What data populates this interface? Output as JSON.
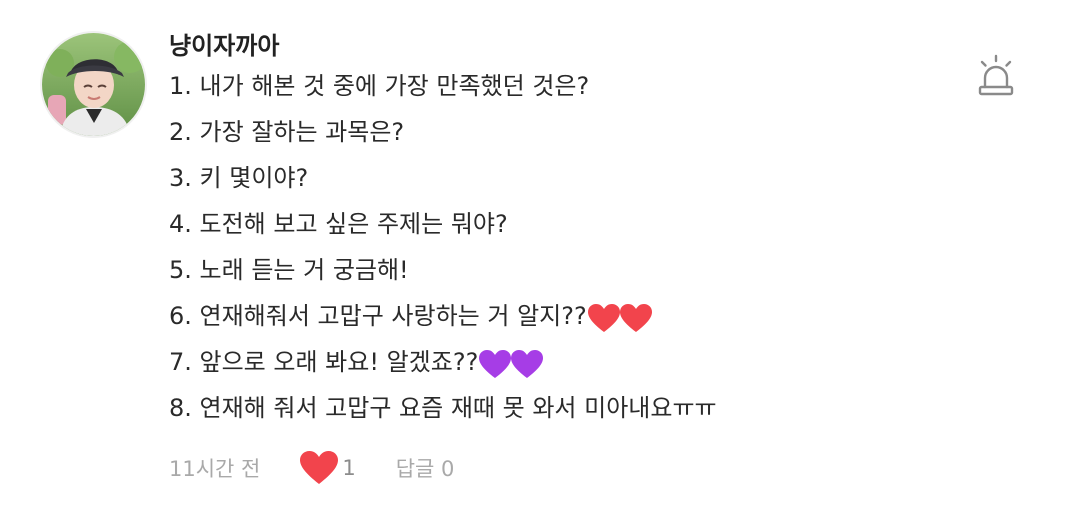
{
  "comment": {
    "author": "냥이자까아",
    "lines": [
      "1. 내가 해본 것 중에 가장 만족했던 것은?",
      "2. 가장 잘하는 과목은?",
      "3. 키 몇이야?",
      "4. 도전해 보고 싶은 주제는 뭐야?",
      "5. 노래 듣는 거 궁금해!",
      "6. 연재해줘서 고맙구 사랑하는 거 알지??",
      "7. 앞으로 오래 봐요! 알겠죠??",
      "8. 연재해 줘서 고맙구 요즘 재때 못 와서 미아내요ㅠㅠ"
    ],
    "emoji": {
      "line6": "red-hearts",
      "line7": "purple-hearts"
    },
    "timestamp": "11시간 전",
    "like_count": "1",
    "reply_label": "답글 0"
  },
  "colors": {
    "heart_red": "#f2444c",
    "heart_purple": "#a63de6",
    "meta_text": "#a9a9a9",
    "icon_stroke": "#8a8a8a"
  },
  "icons": {
    "like": "heart-icon",
    "report": "siren-icon"
  }
}
